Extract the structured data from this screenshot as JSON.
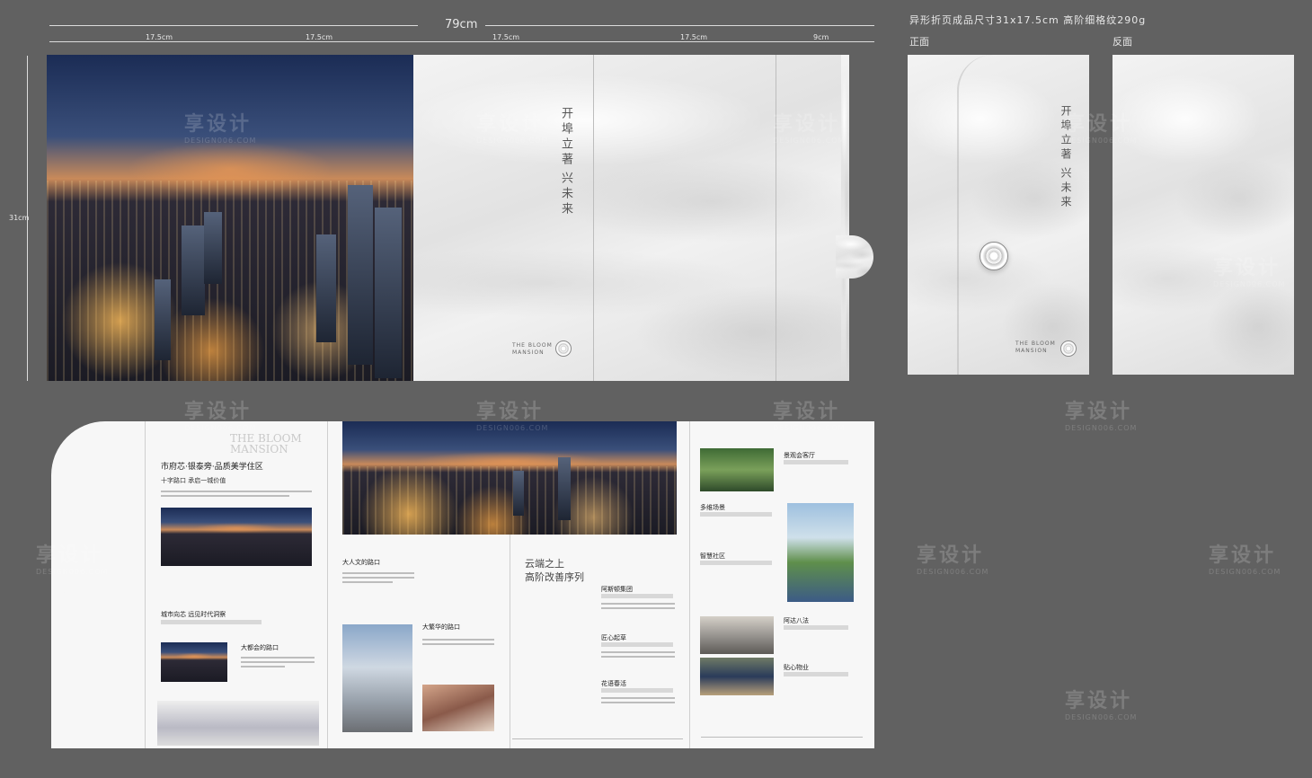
{
  "spec": {
    "total_width": "79cm",
    "segments": [
      "17.5cm",
      "17.5cm",
      "17.5cm",
      "17.5cm",
      "9cm"
    ],
    "height": "31cm",
    "note": "异形折页成品尺寸31x17.5cm  高阶细格纹290g",
    "front_label": "正面",
    "back_label": "反面"
  },
  "cover": {
    "slogan_line1": "开埠立著",
    "slogan_line2": "兴未来",
    "brand": "THE BLOOM MANSION"
  },
  "inner": {
    "panel1": {
      "title": "市府芯·银泰旁·品质美学住区",
      "subtitle": "十字路口 承启一城价值",
      "watermark_en": "THE BLOOM MANSION",
      "section2_title": "城市向芯 远见时代洞察",
      "section3_title": "大都会的路口"
    },
    "panel2": {
      "section1_title": "大人文的路口",
      "section2_title": "大繁华的路口"
    },
    "panel3": {
      "heading_line1": "云端之上",
      "heading_line2": "高阶改善序列",
      "items": [
        "阿斯顿集团",
        "匠心起草",
        "花语春活"
      ]
    },
    "panel4": {
      "items": [
        "景观会客厅",
        "多维场景",
        "智慧社区",
        "阿达八法",
        "贴心物业"
      ]
    }
  },
  "watermark": {
    "text": "享设计",
    "sub": "DESIGN006.COM"
  },
  "colors": {
    "background": "#616161",
    "paper": "#f4f4f4",
    "accent": "#c9c9c9"
  }
}
